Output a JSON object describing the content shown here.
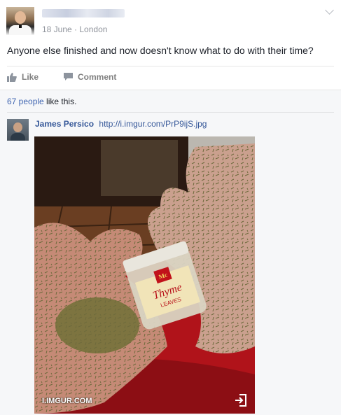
{
  "post": {
    "meta": "18 June · London",
    "text": "Anyone else finished and now doesn't know what to do with their time?",
    "actions": {
      "like": "Like",
      "comment": "Comment"
    }
  },
  "likes": {
    "count_link": "67 people",
    "suffix": " like this."
  },
  "comment": {
    "author": "James Persico",
    "url": "http://i.imgur.com/PrP9ijS.jpg",
    "photo": {
      "source_label": "I.IMGUR.COM",
      "jar_brand": "Mc",
      "jar_label": "Thyme",
      "jar_sublabel": "LEAVES"
    }
  },
  "colors": {
    "link": "#365899",
    "muted": "#90949c",
    "panel": "#f6f7f9"
  }
}
